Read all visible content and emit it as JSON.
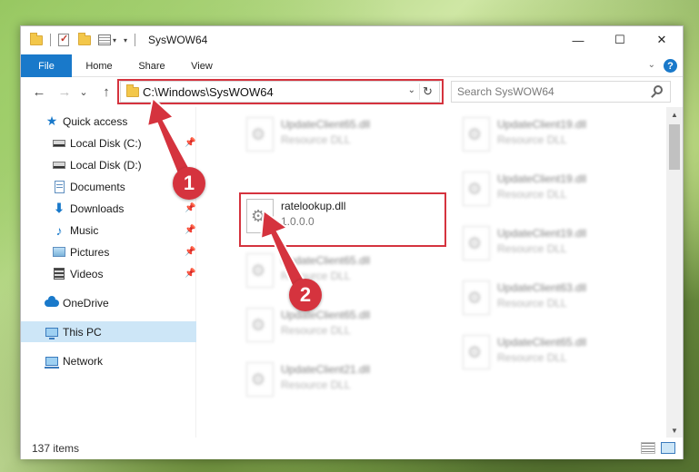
{
  "window": {
    "title": "SysWOW64",
    "minimize_glyph": "—",
    "maximize_glyph": "☐",
    "close_glyph": "✕"
  },
  "ribbon": {
    "tabs": [
      "File",
      "Home",
      "Share",
      "View"
    ],
    "help_glyph": "?",
    "expand_glyph": "⌄"
  },
  "nav": {
    "back_glyph": "←",
    "forward_glyph": "→",
    "recent_glyph": "⌄",
    "up_glyph": "↑"
  },
  "address": {
    "path": "C:\\Windows\\SysWOW64",
    "dropdown_glyph": "⌄",
    "refresh_glyph": "↻"
  },
  "search": {
    "placeholder": "Search SysWOW64"
  },
  "sidebar": {
    "items": [
      {
        "label": "Quick access",
        "icon": "star-icon",
        "pinned": false
      },
      {
        "label": "Local Disk (C:)",
        "icon": "drive-icon",
        "pinned": true
      },
      {
        "label": "Local Disk (D:)",
        "icon": "drive-icon",
        "pinned": false
      },
      {
        "label": "Documents",
        "icon": "documents-icon",
        "pinned": true
      },
      {
        "label": "Downloads",
        "icon": "downloads-icon",
        "pinned": true
      },
      {
        "label": "Music",
        "icon": "music-icon",
        "pinned": true
      },
      {
        "label": "Pictures",
        "icon": "pictures-icon",
        "pinned": true
      },
      {
        "label": "Videos",
        "icon": "videos-icon",
        "pinned": true
      },
      {
        "label": "OneDrive",
        "icon": "onedrive-icon",
        "pinned": false
      },
      {
        "label": "This PC",
        "icon": "this-pc-icon",
        "pinned": false,
        "selected": true
      },
      {
        "label": "Network",
        "icon": "network-icon",
        "pinned": false
      }
    ],
    "pin_glyph": "📌"
  },
  "files": {
    "highlighted": {
      "name": "ratelookup.dll",
      "version": "1.0.0.0"
    },
    "blurred_left": [
      {
        "name": "UpdateClient65.dll",
        "type": "Resource DLL"
      },
      {
        "name": "UpdateClient65.dll",
        "type": "Resource DLL"
      },
      {
        "name": "UpdateClient65.dll",
        "type": "Resource DLL"
      },
      {
        "name": "UpdateClient21.dll",
        "type": "Resource DLL"
      }
    ],
    "blurred_right": [
      {
        "name": "UpdateClient19.dll",
        "type": "Resource DLL"
      },
      {
        "name": "UpdateClient19.dll",
        "type": "Resource DLL"
      },
      {
        "name": "UpdateClient19.dll",
        "type": "Resource DLL"
      },
      {
        "name": "UpdateClient63.dll",
        "type": "Resource DLL"
      },
      {
        "name": "UpdateClient65.dll",
        "type": "Resource DLL"
      }
    ]
  },
  "status": {
    "item_count": "137 items"
  },
  "annotations": {
    "step1": "1",
    "step2": "2",
    "color": "#d5333e"
  },
  "colors": {
    "accent": "#1979ca",
    "selection": "#cde6f7",
    "highlight": "#d5333e"
  }
}
